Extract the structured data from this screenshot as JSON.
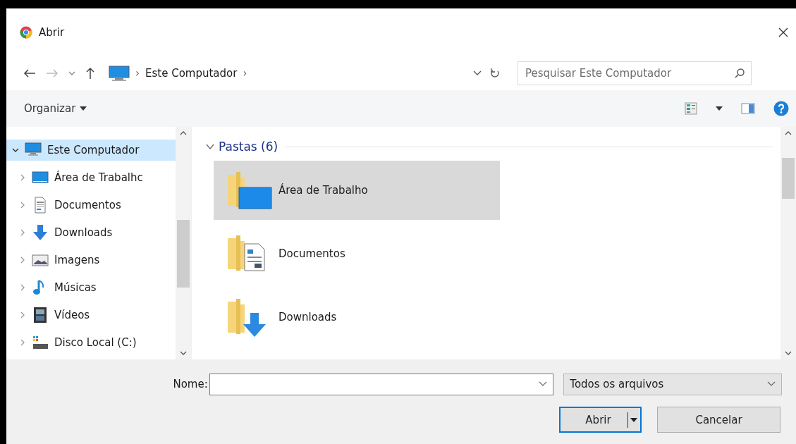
{
  "window": {
    "title": "Abrir"
  },
  "address_bar": {
    "breadcrumb": "Este Computador",
    "separator_before": "›",
    "separator_after": "›"
  },
  "search": {
    "placeholder": "Pesquisar Este Computador"
  },
  "toolbar": {
    "organize": "Organizar"
  },
  "sidebar": {
    "items": [
      {
        "label": "Este Computador",
        "kind": "computer",
        "expanded": true,
        "selected": true,
        "children": [
          {
            "label": "Área de Trabalhc",
            "kind": "desktop",
            "expanded": false,
            "selected": false
          },
          {
            "label": "Documentos",
            "kind": "document",
            "expanded": false,
            "selected": false
          },
          {
            "label": "Downloads",
            "kind": "download",
            "expanded": false,
            "selected": false
          },
          {
            "label": "Imagens",
            "kind": "picture",
            "expanded": false,
            "selected": false
          },
          {
            "label": "Músicas",
            "kind": "music",
            "expanded": false,
            "selected": false
          },
          {
            "label": "Vídeos",
            "kind": "video",
            "expanded": false,
            "selected": false
          },
          {
            "label": "Disco Local (C:)",
            "kind": "drive",
            "expanded": false,
            "selected": false
          }
        ]
      }
    ]
  },
  "content": {
    "group": {
      "title": "Pastas (6)",
      "expanded": true
    },
    "items": [
      {
        "label": "Área de Trabalho",
        "kind": "desktop",
        "selected": true
      },
      {
        "label": "Documentos",
        "kind": "document",
        "selected": false
      },
      {
        "label": "Downloads",
        "kind": "download",
        "selected": false
      }
    ]
  },
  "footer": {
    "name_label": "Nome:",
    "filter": "Todos os arquivos",
    "buttons": [
      {
        "label": "Abrir",
        "kind": "split"
      },
      {
        "label": "Cancelar",
        "kind": "plain"
      }
    ]
  }
}
